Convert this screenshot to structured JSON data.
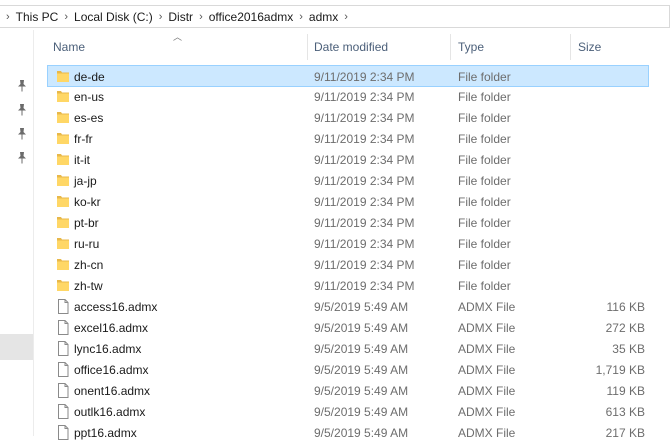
{
  "breadcrumb": {
    "items": [
      "This PC",
      "Local Disk (C:)",
      "Distr",
      "office2016admx",
      "admx"
    ]
  },
  "columns": {
    "name": "Name",
    "date": "Date modified",
    "type": "Type",
    "size": "Size"
  },
  "colors": {
    "folder": "#ffd766",
    "folder_dark": "#e8b84a",
    "selected_bg": "#cce8ff",
    "selected_border": "#99d1ff",
    "header_text": "#4c607a"
  },
  "files": [
    {
      "name": "de-de",
      "date": "9/11/2019 2:34 PM",
      "type": "File folder",
      "size": "",
      "icon": "folder-icon",
      "selected": true
    },
    {
      "name": "en-us",
      "date": "9/11/2019 2:34 PM",
      "type": "File folder",
      "size": "",
      "icon": "folder-icon"
    },
    {
      "name": "es-es",
      "date": "9/11/2019 2:34 PM",
      "type": "File folder",
      "size": "",
      "icon": "folder-icon"
    },
    {
      "name": "fr-fr",
      "date": "9/11/2019 2:34 PM",
      "type": "File folder",
      "size": "",
      "icon": "folder-icon"
    },
    {
      "name": "it-it",
      "date": "9/11/2019 2:34 PM",
      "type": "File folder",
      "size": "",
      "icon": "folder-icon"
    },
    {
      "name": "ja-jp",
      "date": "9/11/2019 2:34 PM",
      "type": "File folder",
      "size": "",
      "icon": "folder-icon"
    },
    {
      "name": "ko-kr",
      "date": "9/11/2019 2:34 PM",
      "type": "File folder",
      "size": "",
      "icon": "folder-icon"
    },
    {
      "name": "pt-br",
      "date": "9/11/2019 2:34 PM",
      "type": "File folder",
      "size": "",
      "icon": "folder-icon"
    },
    {
      "name": "ru-ru",
      "date": "9/11/2019 2:34 PM",
      "type": "File folder",
      "size": "",
      "icon": "folder-icon"
    },
    {
      "name": "zh-cn",
      "date": "9/11/2019 2:34 PM",
      "type": "File folder",
      "size": "",
      "icon": "folder-icon"
    },
    {
      "name": "zh-tw",
      "date": "9/11/2019 2:34 PM",
      "type": "File folder",
      "size": "",
      "icon": "folder-icon"
    },
    {
      "name": "access16.admx",
      "date": "9/5/2019 5:49 AM",
      "type": "ADMX File",
      "size": "116 KB",
      "icon": "file-icon"
    },
    {
      "name": "excel16.admx",
      "date": "9/5/2019 5:49 AM",
      "type": "ADMX File",
      "size": "272 KB",
      "icon": "file-icon"
    },
    {
      "name": "lync16.admx",
      "date": "9/5/2019 5:49 AM",
      "type": "ADMX File",
      "size": "35 KB",
      "icon": "file-icon"
    },
    {
      "name": "office16.admx",
      "date": "9/5/2019 5:49 AM",
      "type": "ADMX File",
      "size": "1,719 KB",
      "icon": "file-icon"
    },
    {
      "name": "onent16.admx",
      "date": "9/5/2019 5:49 AM",
      "type": "ADMX File",
      "size": "119 KB",
      "icon": "file-icon"
    },
    {
      "name": "outlk16.admx",
      "date": "9/5/2019 5:49 AM",
      "type": "ADMX File",
      "size": "613 KB",
      "icon": "file-icon"
    },
    {
      "name": "ppt16.admx",
      "date": "9/5/2019 5:49 AM",
      "type": "ADMX File",
      "size": "217 KB",
      "icon": "file-icon"
    }
  ]
}
